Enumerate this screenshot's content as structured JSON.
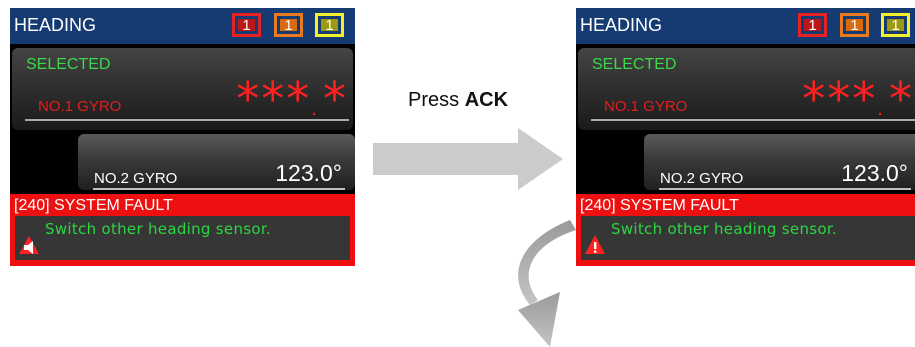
{
  "left_screen": {
    "title": "HEADING",
    "badges": [
      "1",
      "1",
      "1"
    ],
    "selected_label": "SELECTED",
    "gyro1_label": "NO.1 GYRO",
    "gyro1_value_main": "***",
    "gyro1_value_dot": ".",
    "gyro1_value_tail": "*",
    "gyro2_label": "NO.2 GYRO",
    "gyro2_value": "123.0°",
    "alarm_header": "[240]  SYSTEM FAULT",
    "alarm_message": "Switch other heading sensor.",
    "alarm_icon": "speaker-icon"
  },
  "right_screen": {
    "title": "HEADING",
    "badges": [
      "1",
      "1",
      "1"
    ],
    "selected_label": "SELECTED",
    "gyro1_label": "NO.1 GYRO",
    "gyro1_value_main": "***",
    "gyro1_value_dot": ".",
    "gyro1_value_tail": "*",
    "gyro2_label": "NO.2 GYRO",
    "gyro2_value": "123.0°",
    "alarm_header": "[240]  SYSTEM FAULT",
    "alarm_message": "Switch other heading sensor.",
    "alarm_icon": "warning-triangle-icon"
  },
  "transition": {
    "press_prefix": "Press ",
    "press_key": "ACK"
  },
  "colors": {
    "title_bar": "#163b73",
    "selected_green": "#39d94a",
    "fault_red": "#ee1010",
    "badge_red": "#e62222",
    "badge_orange": "#ea7a1e",
    "badge_yellow": "#f3ef2a"
  }
}
